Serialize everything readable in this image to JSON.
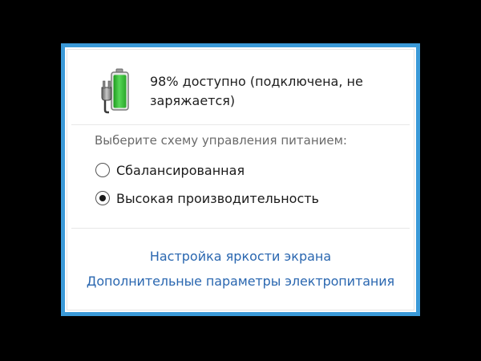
{
  "battery": {
    "status_text": "98% доступно (подключена, не заряжается)",
    "charge_percent": 98,
    "icon": "battery-plugged-icon"
  },
  "power_plans": {
    "prompt": "Выберите схему управления питанием:",
    "options": [
      {
        "label": "Сбалансированная",
        "selected": false
      },
      {
        "label": "Высокая производительность",
        "selected": true
      }
    ]
  },
  "links": {
    "brightness": "Настройка яркости экрана",
    "more_options": "Дополнительные параметры электропитания"
  },
  "colors": {
    "border": "#3b9ad8",
    "link": "#2a67b0",
    "battery_fill": "#3cc33c",
    "background": "#000000"
  }
}
